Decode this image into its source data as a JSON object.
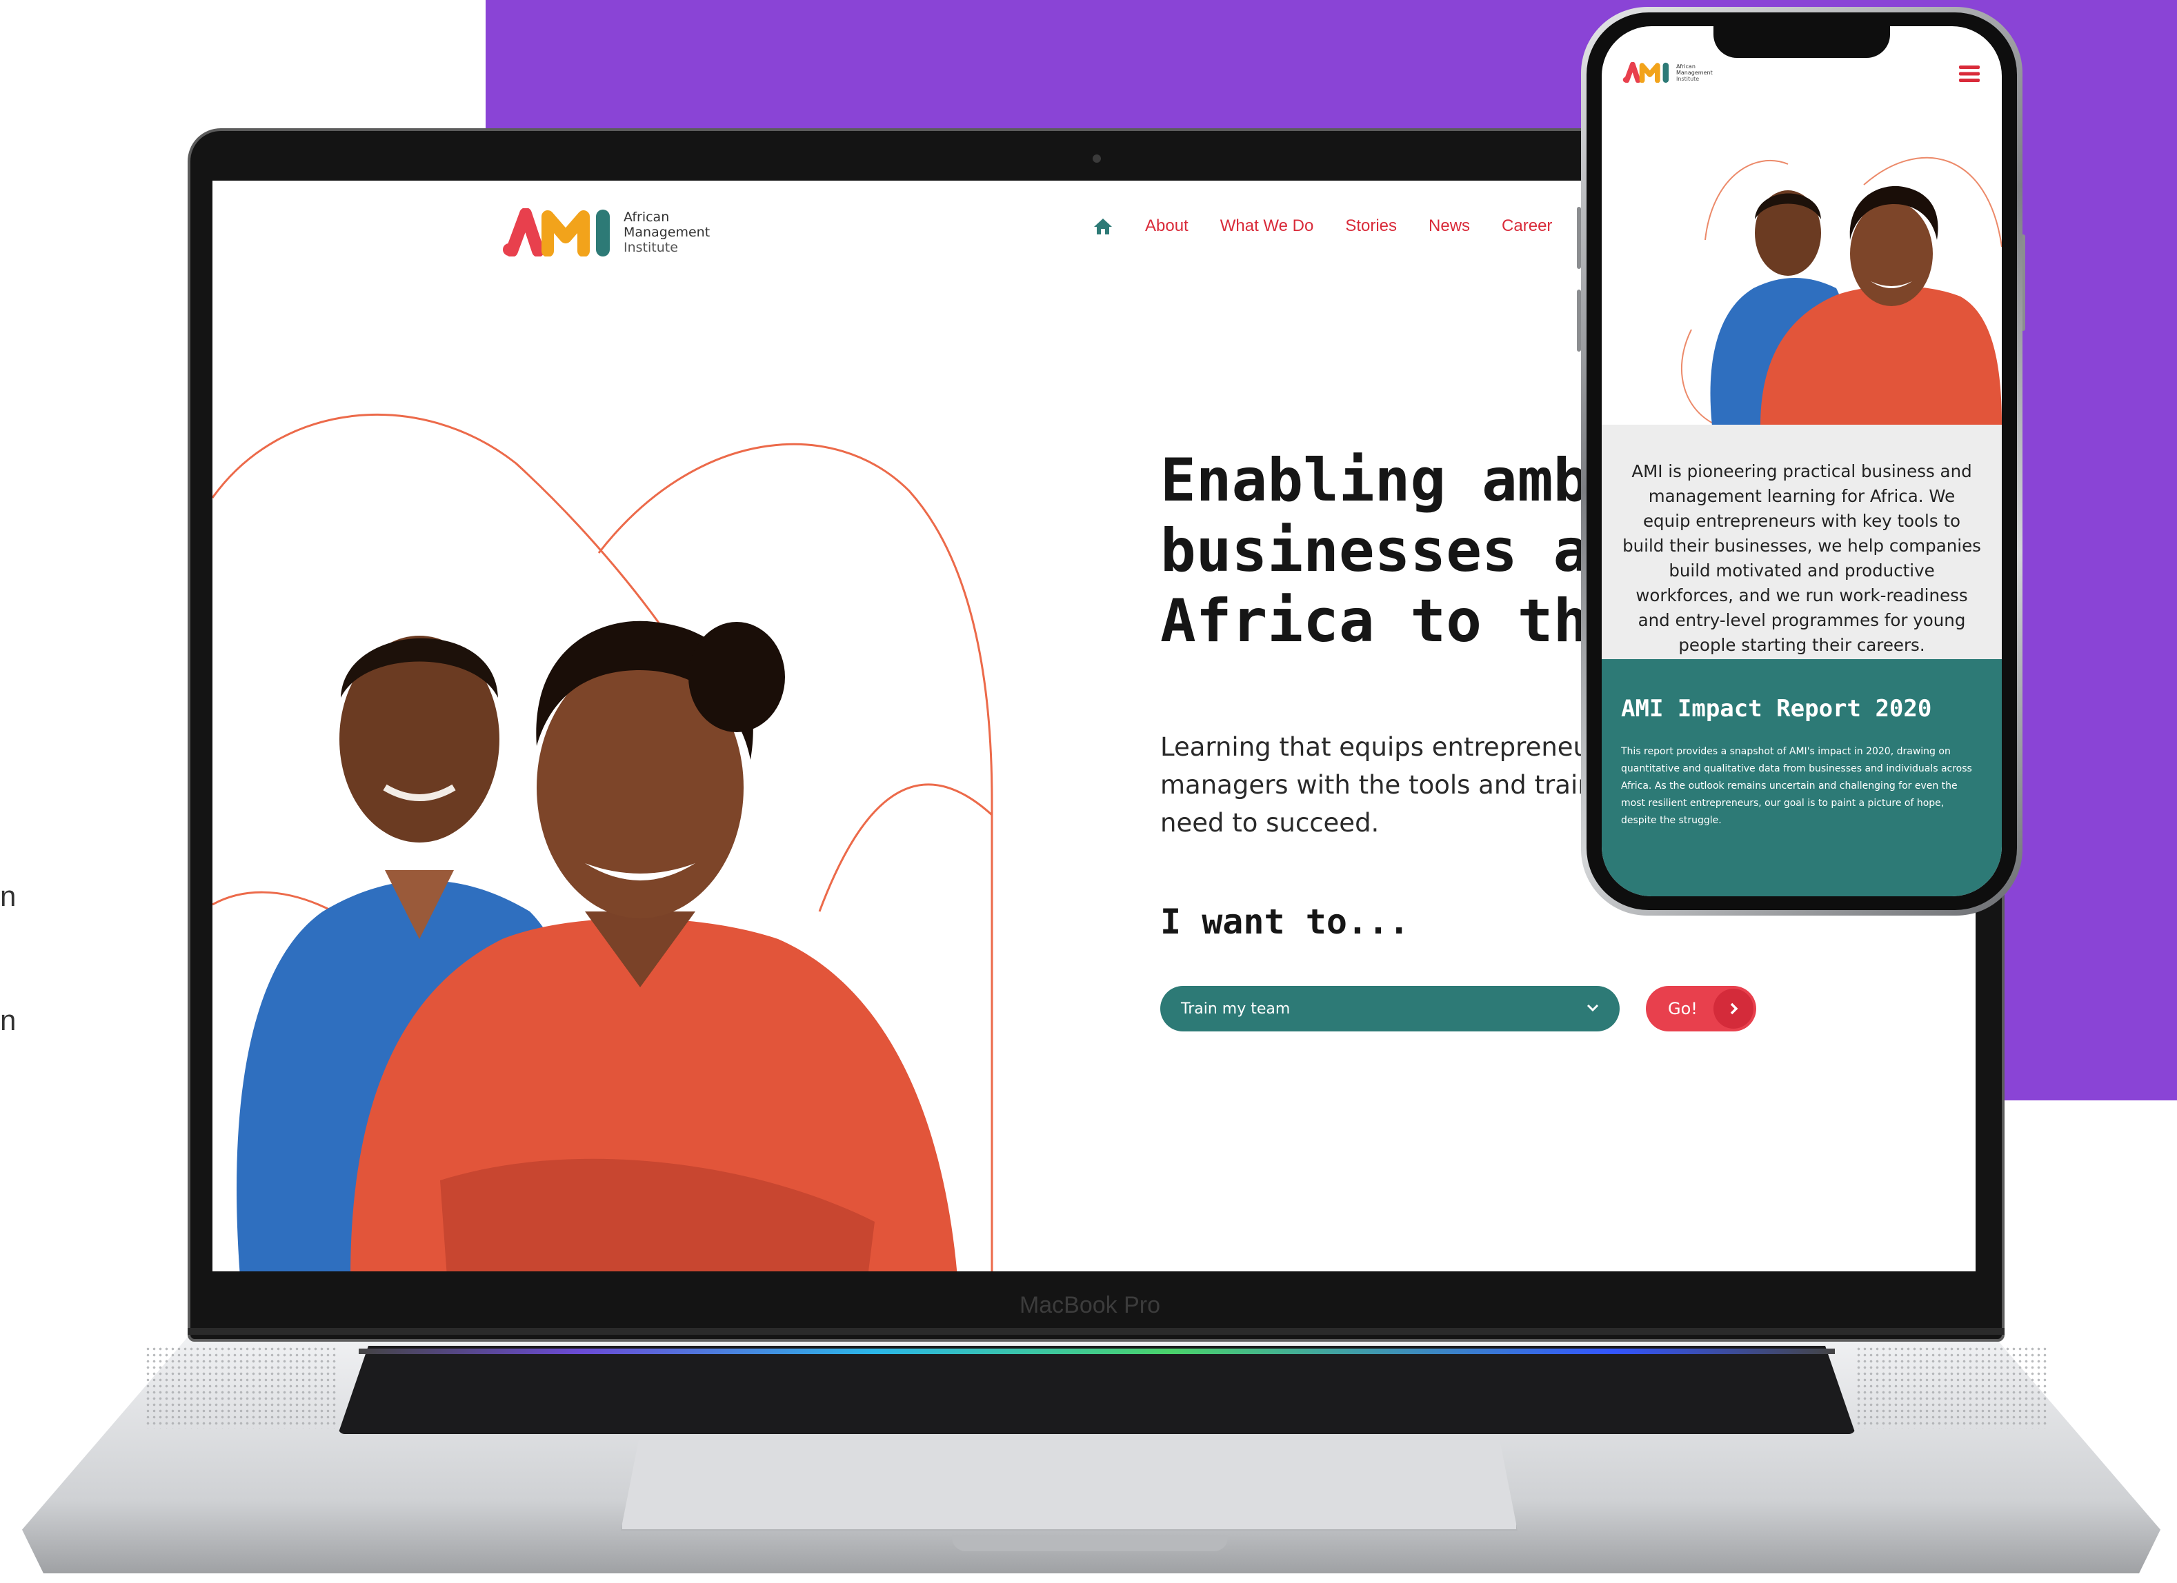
{
  "desktop_site": {
    "logo": {
      "mark": "AMI",
      "line1": "African",
      "line2": "Management",
      "line3": "Institute"
    },
    "nav": {
      "home_icon": "home-icon",
      "items": [
        "About",
        "What We Do",
        "Stories",
        "News",
        "Career"
      ]
    },
    "hero": {
      "headline_lines": [
        "Enabling ambi",
        "businesses ac",
        "Africa to thriv"
      ],
      "sub_lines": [
        "Learning that equips entrepreneu",
        "managers with the tools and trair",
        "need to succeed."
      ],
      "want_label": "I want to...",
      "select_value": "Train my team",
      "go_label": "Go!"
    }
  },
  "laptop": {
    "chin_label": "MacBook Pro"
  },
  "mobile_site": {
    "logo": {
      "mark": "AMI",
      "line1": "African",
      "line2": "Management",
      "line3": "Institute"
    },
    "menu_icon": "hamburger-icon",
    "intro": "AMI is pioneering practical business and management learning for Africa. We equip entrepreneurs with key tools to build their businesses, we help companies build motivated and productive workforces, and we run work-readiness and entry-level programmes for young people starting their careers.",
    "report": {
      "title": "AMI Impact Report 2020",
      "body": "This report provides a snapshot of AMI's impact in 2020, drawing on quantitative and qualitative data from businesses and individuals across Africa. As the outlook remains uncertain and challenging for even the most resilient entrepreneurs, our goal is to paint a picture of hope, despite the struggle."
    }
  },
  "edge_glyphs": [
    "n",
    "n"
  ],
  "colors": {
    "purple": "#8a44d6",
    "brand_red": "#e8404d",
    "teal": "#2d7a76",
    "nav_red": "#d92b3a"
  }
}
